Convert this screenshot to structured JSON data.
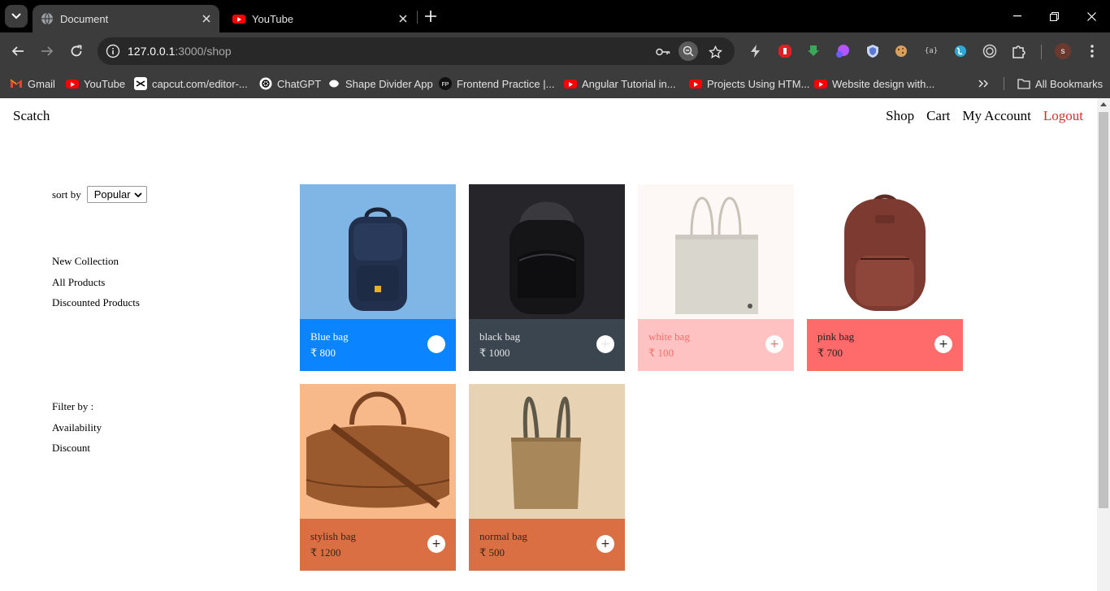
{
  "browser": {
    "tabs": [
      {
        "title": "Document",
        "icon": "globe-icon",
        "active": true
      },
      {
        "title": "YouTube",
        "icon": "youtube-icon",
        "active": false
      }
    ],
    "url_host": "127.0.0.1",
    "url_rest": ":3000/shop",
    "bookmarks": [
      {
        "label": "Gmail",
        "icon": "gmail-icon"
      },
      {
        "label": "YouTube",
        "icon": "youtube-icon"
      },
      {
        "label": "capcut.com/editor-...",
        "icon": "capcut-icon"
      },
      {
        "label": "ChatGPT",
        "icon": "chatgpt-icon"
      },
      {
        "label": "Shape Divider App",
        "icon": "shape-divider-icon"
      },
      {
        "label": "Frontend Practice |...",
        "icon": "fp-icon"
      },
      {
        "label": "Angular Tutorial in...",
        "icon": "youtube-icon"
      },
      {
        "label": "Projects Using HTM...",
        "icon": "youtube-icon"
      },
      {
        "label": "Website design with...",
        "icon": "youtube-icon"
      }
    ],
    "all_bookmarks": "All Bookmarks",
    "profile_initial": "s"
  },
  "site": {
    "brand": "Scatch",
    "nav": {
      "shop": "Shop",
      "cart": "Cart",
      "account": "My Account",
      "logout": "Logout"
    },
    "sort_label": "sort by",
    "sort_value": "Popular",
    "collections": [
      "New Collection",
      "All Products",
      "Discounted Products"
    ],
    "filter_label": "Filter by :",
    "filters": [
      "Availability",
      "Discount"
    ]
  },
  "products": [
    {
      "name": "Blue bag",
      "price": "₹ 800",
      "bg": "#7fb6e6",
      "panel": "#0a84ff",
      "text": "#ffffff",
      "kind": "backpack-navy"
    },
    {
      "name": "black bag",
      "price": "₹ 1000",
      "bg": "#26262a",
      "panel": "#3a4550",
      "text": "#e6e6e6",
      "kind": "backpack-black"
    },
    {
      "name": "white bag",
      "price": "₹ 100",
      "bg": "#fdf7f6",
      "panel": "#ffc2c2",
      "text": "#f0706a",
      "kind": "tote-white"
    },
    {
      "name": "pink bag",
      "price": "₹ 700",
      "bg": "#ffffff",
      "panel": "#ff6b6b",
      "text": "#222222",
      "kind": "backpack-brown"
    },
    {
      "name": "stylish bag",
      "price": "₹ 1200",
      "bg": "#f7b98a",
      "panel": "#d96f42",
      "text": "#3a2418",
      "kind": "duffel-brown"
    },
    {
      "name": "normal bag",
      "price": "₹ 500",
      "bg": "#e8d2b4",
      "panel": "#d96f42",
      "text": "#3a2418",
      "kind": "tote-kraft"
    }
  ]
}
